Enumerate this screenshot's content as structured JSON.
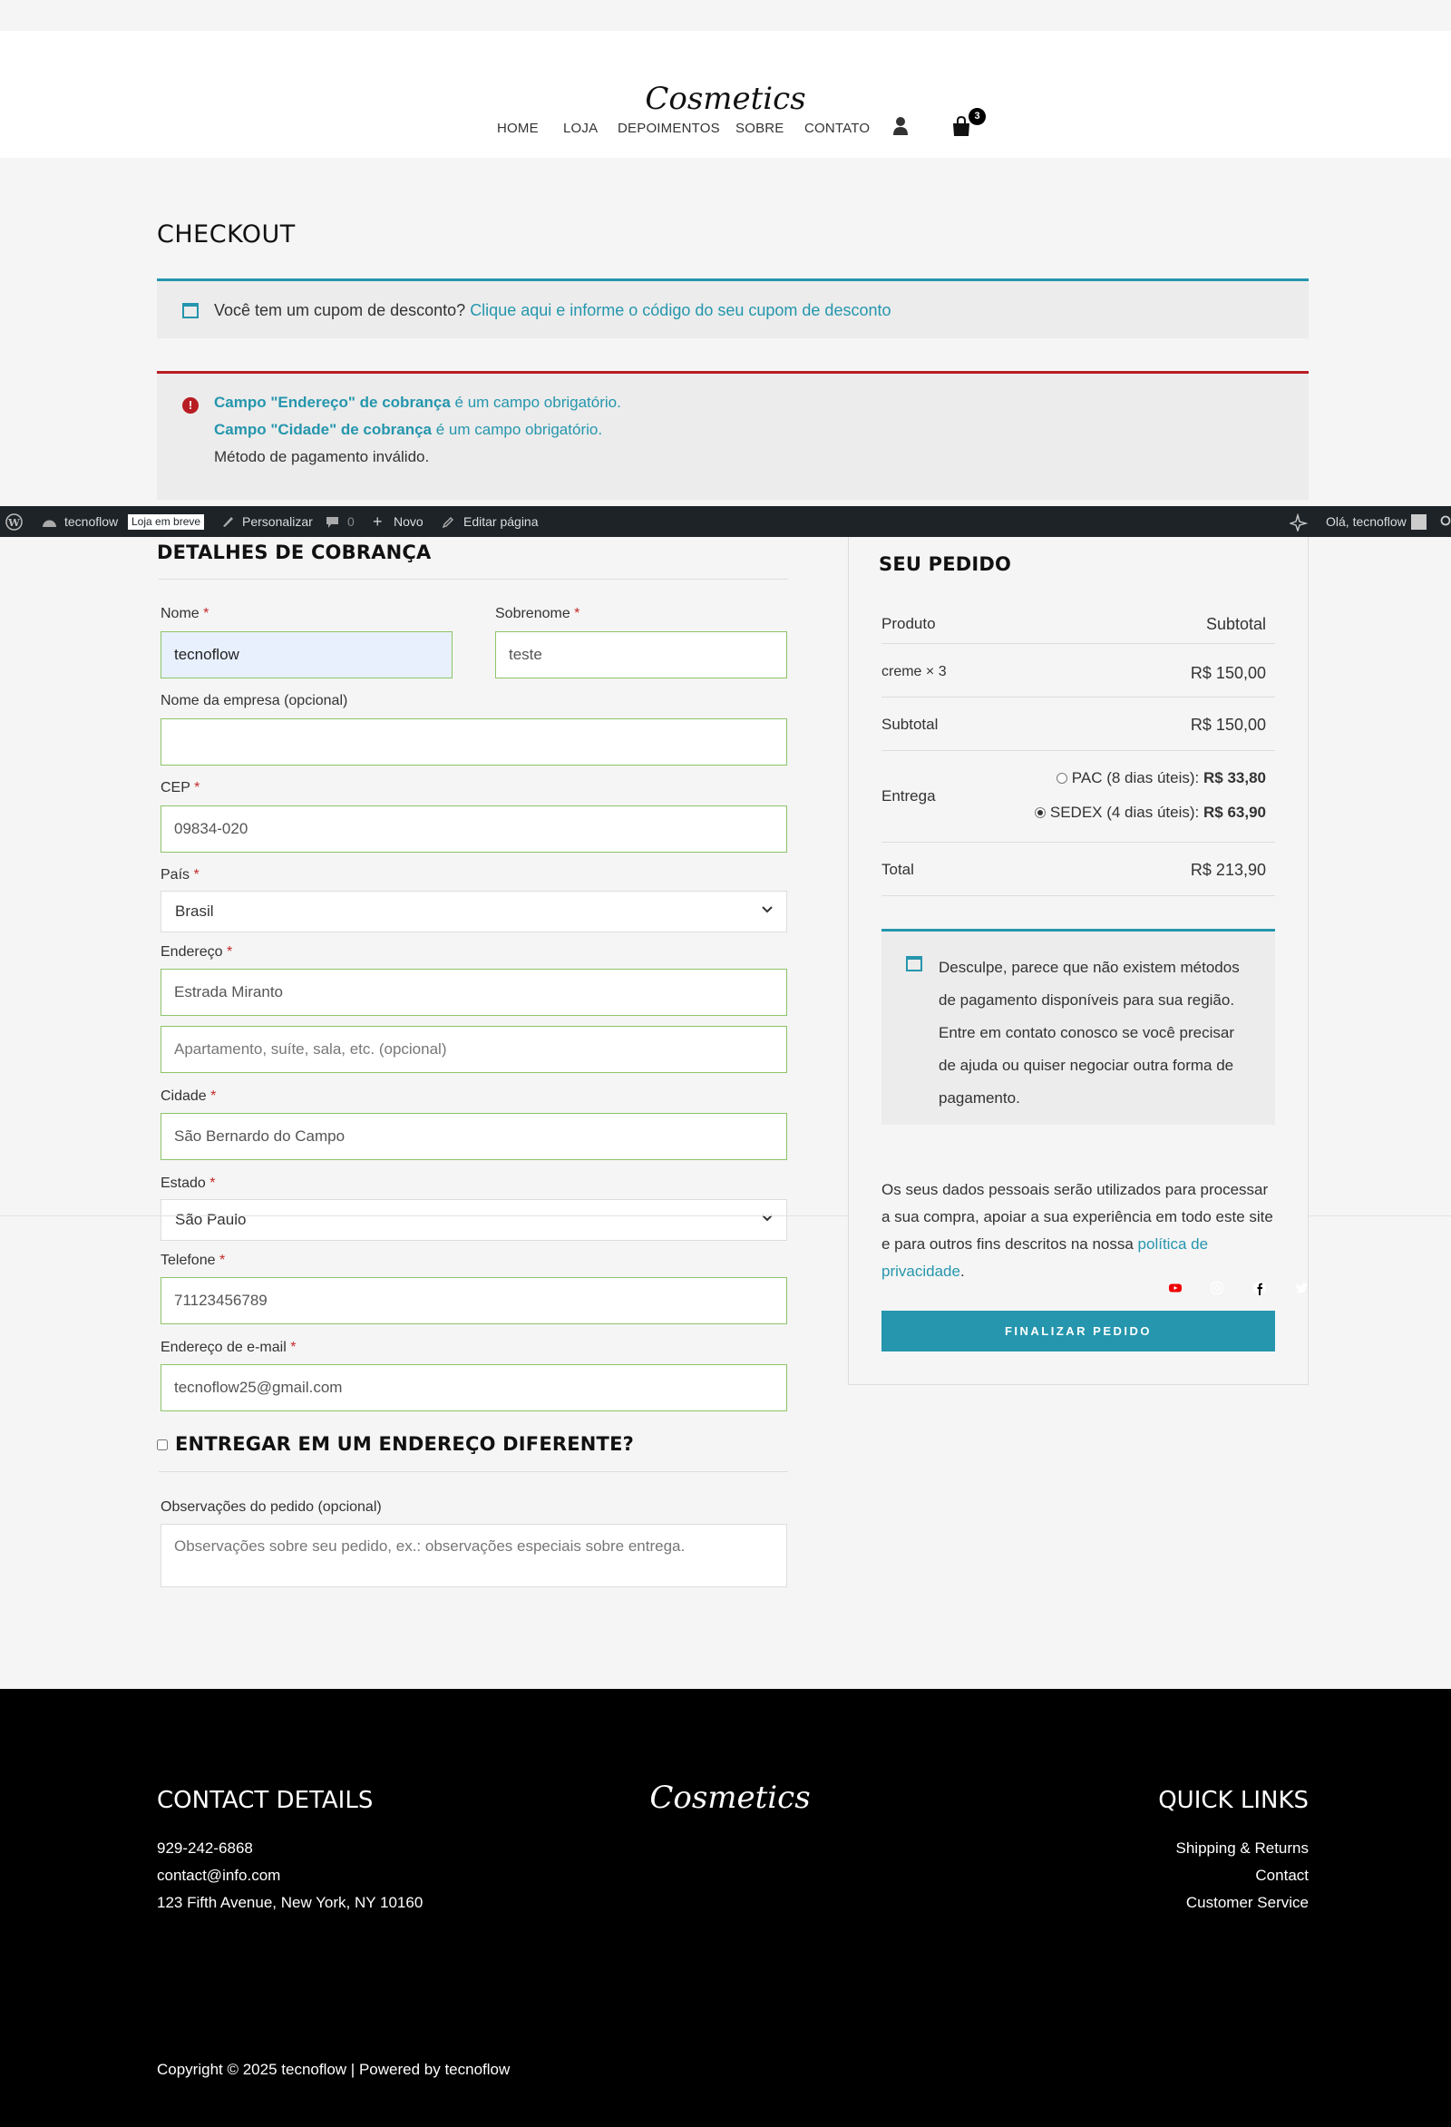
{
  "header": {
    "logo_text": "Cosmetics",
    "nav": [
      "HOME",
      "LOJA",
      "DEPOIMENTOS",
      "SOBRE",
      "CONTATO"
    ],
    "cart_count": "3"
  },
  "page": {
    "title": "CHECKOUT"
  },
  "coupon_notice": {
    "text": "Você tem um cupom de desconto?",
    "link": "Clique aqui e informe o código do seu cupom de desconto"
  },
  "errors": {
    "e1_field": "Campo \"Endereço\" de cobrança",
    "e1_rest": " é um campo obrigatório.",
    "e2_field": "Campo \"Cidade\" de cobrança",
    "e2_rest": " é um campo obrigatório.",
    "e3": "Método de pagamento inválido."
  },
  "admin_bar": {
    "site": "tecnoflow",
    "badge": "Loja em breve",
    "customize": "Personalizar",
    "comments": "0",
    "new": "Novo",
    "edit": "Editar página",
    "greeting": "Olá, tecnoflow"
  },
  "billing": {
    "title": "DETALHES DE COBRANÇA",
    "first_name_label": "Nome",
    "first_name": "tecnoflow",
    "last_name_label": "Sobrenome",
    "last_name": "teste",
    "company_label": "Nome da empresa (opcional)",
    "company": "",
    "cep_label": "CEP",
    "cep": "09834-020",
    "country_label": "País",
    "country": "Brasil",
    "address_label": "Endereço",
    "address": "Estrada Miranto",
    "address2_placeholder": "Apartamento, suíte, sala, etc. (opcional)",
    "city_label": "Cidade",
    "city": "São Bernardo do Campo",
    "state_label": "Estado",
    "state": "São Paulo",
    "phone_label": "Telefone",
    "phone": "71123456789",
    "email_label": "Endereço de e-mail",
    "email": "tecnoflow25@gmail.com",
    "ship_diff": "ENTREGAR EM UM ENDEREÇO DIFERENTE?",
    "notes_label": "Observações do pedido (opcional)",
    "notes_placeholder": "Observações sobre seu pedido, ex.: observações especiais sobre entrega.",
    "required_mark": "*"
  },
  "order": {
    "title": "SEU PEDIDO",
    "col_product": "Produto",
    "col_subtotal": "Subtotal",
    "item_name": "creme × 3",
    "item_total": "R$ 150,00",
    "subtotal_label": "Subtotal",
    "subtotal": "R$ 150,00",
    "shipping_label": "Entrega",
    "ship_pac_label": "PAC (8 dias úteis):",
    "ship_pac_price": "R$ 33,80",
    "ship_sedex_label": "SEDEX (4 dias úteis):",
    "ship_sedex_price": "R$ 63,90",
    "total_label": "Total",
    "total": "R$ 213,90",
    "payment_notice": "Desculpe, parece que não existem métodos de pagamento disponíveis para sua região. Entre em contato conosco se você precisar de ajuda ou quiser negociar outra forma de pagamento.",
    "privacy_text": "Os seus dados pessoais serão utilizados para processar a sua compra, apoiar a sua experiência em todo este site e para outros fins descritos na nossa ",
    "privacy_link": "política de privacidade",
    "privacy_end": ".",
    "place_order": "FINALIZAR PEDIDO"
  },
  "footer": {
    "contact_title": "CONTACT DETAILS",
    "phone": "929-242-6868",
    "email": "contact@info.com",
    "address": "123 Fifth Avenue, New York, NY 10160",
    "links_title": "QUICK LINKS",
    "links": [
      "Shipping & Returns",
      "Contact",
      "Customer Service"
    ],
    "copyright": "Copyright © 2025 tecnoflow | Powered by tecnoflow",
    "logo_text": "Cosmetics"
  },
  "colors": {
    "accent": "#2596ad",
    "error": "#b81c23",
    "valid_border": "#8cc468"
  },
  "icons": [
    "user-icon",
    "cart-icon",
    "calendar-icon",
    "error-icon",
    "wordpress-icon",
    "youtube-icon",
    "instagram-icon",
    "facebook-icon",
    "twitter-icon"
  ]
}
